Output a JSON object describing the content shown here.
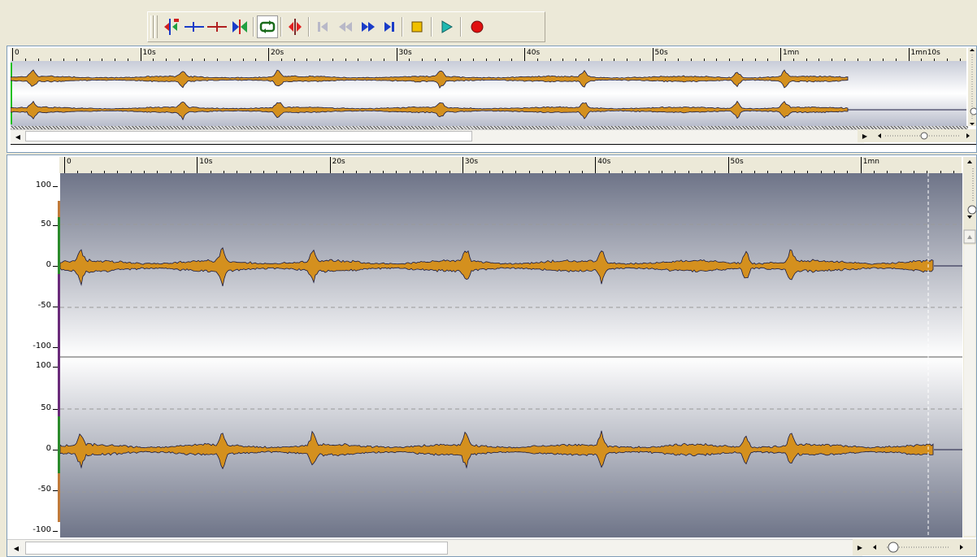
{
  "toolbar": {
    "buttons": [
      {
        "name": "insert-marker-icon"
      },
      {
        "name": "marker-blue-icon"
      },
      {
        "name": "marker-red-icon"
      },
      {
        "name": "marker-range-icon"
      },
      {
        "name": "loop-icon"
      },
      {
        "name": "split-marker-icon"
      },
      {
        "name": "go-start-icon"
      },
      {
        "name": "rewind-icon"
      },
      {
        "name": "fast-forward-icon"
      },
      {
        "name": "go-end-icon"
      },
      {
        "name": "stop-icon"
      },
      {
        "name": "play-icon"
      },
      {
        "name": "record-icon"
      }
    ]
  },
  "overview": {
    "ruler_labels": [
      "0",
      "10s",
      "20s",
      "30s",
      "40s",
      "50s",
      "1mn",
      "1mn10s"
    ]
  },
  "detail": {
    "ruler_labels": [
      "0",
      "10s",
      "20s",
      "30s",
      "40s",
      "50s",
      "1mn"
    ],
    "channel1_y_labels": [
      "100",
      "50",
      "0",
      "-50",
      "-100"
    ],
    "channel2_y_labels": [
      "100",
      "50",
      "0",
      "-50",
      "-100"
    ]
  },
  "colors": {
    "waveform_fill": "#d4901e",
    "waveform_outline": "#1a1a40",
    "plot_bg_dark": "#6e7488",
    "plot_bg_light": "#ffffff"
  }
}
